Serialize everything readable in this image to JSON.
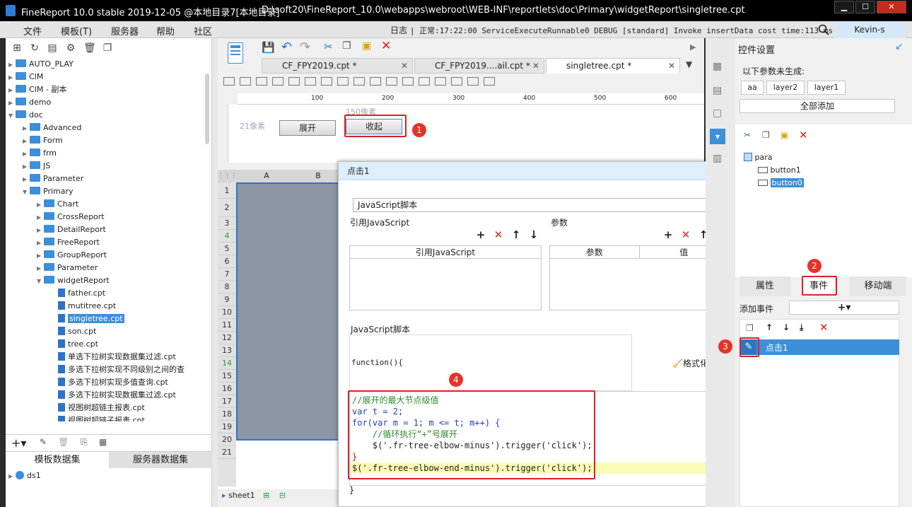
{
  "window": {
    "title": "FineReport 10.0 stable 2019-12-05 @本地目录7[本地目录]",
    "path": "D:\\soft20\\FineReport_10.0\\webapps\\webroot\\WEB-INF\\reportlets\\doc\\Primary\\widgetReport\\singletree.cpt",
    "min": "▁",
    "max": "☐",
    "close": "✕"
  },
  "menu": [
    "文件",
    "模板(T)",
    "服务器",
    "帮助",
    "社区"
  ],
  "log": {
    "label": "日志",
    "text": "| 正常:17:22:00 ServiceExecuteRunnable0 DEBUG [standard] Invoke insertData cost time:113 ms"
  },
  "user": "Kevin-s",
  "tree": [
    {
      "label": "AUTO_PLAY",
      "depth": 0,
      "type": "folder",
      "open": false
    },
    {
      "label": "CIM",
      "depth": 0,
      "type": "folder",
      "open": false
    },
    {
      "label": "CIM - 副本",
      "depth": 0,
      "type": "folder",
      "open": false
    },
    {
      "label": "demo",
      "depth": 0,
      "type": "folder",
      "open": false
    },
    {
      "label": "doc",
      "depth": 0,
      "type": "folder",
      "open": true
    },
    {
      "label": "Advanced",
      "depth": 1,
      "type": "folder",
      "open": false
    },
    {
      "label": "Form",
      "depth": 1,
      "type": "folder",
      "open": false
    },
    {
      "label": "frm",
      "depth": 1,
      "type": "folder",
      "open": false
    },
    {
      "label": "JS",
      "depth": 1,
      "type": "folder",
      "open": false
    },
    {
      "label": "Parameter",
      "depth": 1,
      "type": "folder",
      "open": false
    },
    {
      "label": "Primary",
      "depth": 1,
      "type": "folder",
      "open": true
    },
    {
      "label": "Chart",
      "depth": 2,
      "type": "folder",
      "open": false
    },
    {
      "label": "CrossReport",
      "depth": 2,
      "type": "folder",
      "open": false
    },
    {
      "label": "DetailReport",
      "depth": 2,
      "type": "folder",
      "open": false
    },
    {
      "label": "FreeReport",
      "depth": 2,
      "type": "folder",
      "open": false
    },
    {
      "label": "GroupReport",
      "depth": 2,
      "type": "folder",
      "open": false
    },
    {
      "label": "Parameter",
      "depth": 2,
      "type": "folder",
      "open": false
    },
    {
      "label": "widgetReport",
      "depth": 2,
      "type": "folder",
      "open": true
    },
    {
      "label": "father.cpt",
      "depth": 3,
      "type": "file"
    },
    {
      "label": "mutitree.cpt",
      "depth": 3,
      "type": "file"
    },
    {
      "label": "singletree.cpt",
      "depth": 3,
      "type": "file",
      "selected": true
    },
    {
      "label": "son.cpt",
      "depth": 3,
      "type": "file"
    },
    {
      "label": "tree.cpt",
      "depth": 3,
      "type": "file"
    },
    {
      "label": "单选下拉树实现数据集过滤.cpt",
      "depth": 3,
      "type": "file"
    },
    {
      "label": "多选下拉树实现不同级别之间的查",
      "depth": 3,
      "type": "file"
    },
    {
      "label": "多选下拉树实现多值查询.cpt",
      "depth": 3,
      "type": "file"
    },
    {
      "label": "多选下拉树实现数据集过滤.cpt",
      "depth": 3,
      "type": "file"
    },
    {
      "label": "视图树超链主报表.cpt",
      "depth": 3,
      "type": "file"
    },
    {
      "label": "视图树超链子报表.cpt",
      "depth": 3,
      "type": "file"
    }
  ],
  "datasets": {
    "tab_template": "模板数据集",
    "tab_server": "服务器数据集",
    "item": "ds1"
  },
  "tabs": [
    {
      "label": "CF_FPY2019.cpt *",
      "close": "✕"
    },
    {
      "label": "CF_FPY2019....ail.cpt *",
      "close": "✕"
    },
    {
      "label": "singletree.cpt *",
      "close": "✕"
    }
  ],
  "ruler": {
    "ticks": [
      "100",
      "200",
      "300",
      "400",
      "500",
      "600"
    ]
  },
  "param": {
    "height_hint": "150像素",
    "row_hint": "21像素",
    "btn_expand": "展开",
    "btn_collapse": "收起"
  },
  "sheet": {
    "col_a": "A",
    "col_b": "B",
    "rows": [
      "1",
      "2",
      "3",
      "4",
      "5",
      "6",
      "7",
      "8",
      "9",
      "10",
      "11",
      "12",
      "13",
      "14",
      "15",
      "16",
      "17",
      "18",
      "19",
      "20",
      "21"
    ],
    "sheet_tab": "sheet1"
  },
  "badges": [
    "1",
    "2",
    "3",
    "4"
  ],
  "dialog": {
    "title": "点击1",
    "type": "JavaScript脚本",
    "ref_label": "引用JavaScript",
    "param_label": "参数",
    "ref_col": "引用JavaScript",
    "param_col": "参数",
    "value_col": "值",
    "script_label": "JavaScript脚本",
    "function_open": "function(){",
    "format_label": "格式化代码",
    "code": [
      "//展开的最大节点级值",
      "var t = 2;",
      "for(var m = 1; m <= t; m++) {",
      "    //循环执行“+”号展开",
      "    $('.fr-tree-elbow-minus').trigger('click');",
      "}",
      "$('.fr-tree-elbow-end-minus').trigger('click');"
    ],
    "function_close": "}"
  },
  "right": {
    "title": "控件设置",
    "missing_label": "以下参数未生成:",
    "params": [
      "aa",
      "layer2",
      "layer1"
    ],
    "add_all": "全部添加",
    "widget_tree": {
      "root": "para",
      "items": [
        "button1",
        "button0"
      ]
    },
    "tabs": [
      "属性",
      "事件",
      "移动端"
    ],
    "add_event": "添加事件",
    "event": "点击1"
  }
}
